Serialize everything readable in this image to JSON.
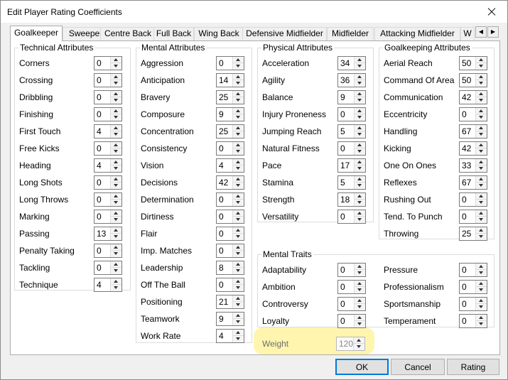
{
  "window": {
    "title": "Edit Player Rating Coefficients"
  },
  "tabs": [
    "Goalkeeper",
    "Sweeper",
    "Centre Back",
    "Full Back",
    "Wing Back",
    "Defensive Midfielder",
    "Midfielder",
    "Attacking Midfielder",
    "W"
  ],
  "active_tab": "Goalkeeper",
  "icons": {
    "close": "close-icon",
    "tab_left": "chevron-left-icon",
    "tab_right": "chevron-right-icon",
    "spin_up": "arrow-up-icon",
    "spin_down": "arrow-down-icon"
  },
  "groups": {
    "technical": {
      "legend": "Technical Attributes",
      "items": [
        {
          "label": "Corners",
          "value": "0"
        },
        {
          "label": "Crossing",
          "value": "0"
        },
        {
          "label": "Dribbling",
          "value": "0"
        },
        {
          "label": "Finishing",
          "value": "0"
        },
        {
          "label": "First Touch",
          "value": "4"
        },
        {
          "label": "Free Kicks",
          "value": "0"
        },
        {
          "label": "Heading",
          "value": "4"
        },
        {
          "label": "Long Shots",
          "value": "0"
        },
        {
          "label": "Long Throws",
          "value": "0"
        },
        {
          "label": "Marking",
          "value": "0"
        },
        {
          "label": "Passing",
          "value": "13"
        },
        {
          "label": "Penalty Taking",
          "value": "0"
        },
        {
          "label": "Tackling",
          "value": "0"
        },
        {
          "label": "Technique",
          "value": "4"
        }
      ]
    },
    "mental": {
      "legend": "Mental Attributes",
      "items": [
        {
          "label": "Aggression",
          "value": "0"
        },
        {
          "label": "Anticipation",
          "value": "14"
        },
        {
          "label": "Bravery",
          "value": "25"
        },
        {
          "label": "Composure",
          "value": "9"
        },
        {
          "label": "Concentration",
          "value": "25"
        },
        {
          "label": "Consistency",
          "value": "0"
        },
        {
          "label": "Vision",
          "value": "4"
        },
        {
          "label": "Decisions",
          "value": "42"
        },
        {
          "label": "Determination",
          "value": "0"
        },
        {
          "label": "Dirtiness",
          "value": "0"
        },
        {
          "label": "Flair",
          "value": "0"
        },
        {
          "label": "Imp. Matches",
          "value": "0"
        },
        {
          "label": "Leadership",
          "value": "8"
        },
        {
          "label": "Off The Ball",
          "value": "0"
        },
        {
          "label": "Positioning",
          "value": "21"
        },
        {
          "label": "Teamwork",
          "value": "9"
        },
        {
          "label": "Work Rate",
          "value": "4"
        }
      ]
    },
    "physical": {
      "legend": "Physical Attributes",
      "items": [
        {
          "label": "Acceleration",
          "value": "34"
        },
        {
          "label": "Agility",
          "value": "36"
        },
        {
          "label": "Balance",
          "value": "9"
        },
        {
          "label": "Injury Proneness",
          "value": "0"
        },
        {
          "label": "Jumping Reach",
          "value": "5"
        },
        {
          "label": "Natural Fitness",
          "value": "0"
        },
        {
          "label": "Pace",
          "value": "17"
        },
        {
          "label": "Stamina",
          "value": "5"
        },
        {
          "label": "Strength",
          "value": "18"
        },
        {
          "label": "Versatility",
          "value": "0"
        }
      ]
    },
    "goalkeeping": {
      "legend": "Goalkeeping Attributes",
      "items": [
        {
          "label": "Aerial Reach",
          "value": "50"
        },
        {
          "label": "Command Of Area",
          "value": "50"
        },
        {
          "label": "Communication",
          "value": "42"
        },
        {
          "label": "Eccentricity",
          "value": "0"
        },
        {
          "label": "Handling",
          "value": "67"
        },
        {
          "label": "Kicking",
          "value": "42"
        },
        {
          "label": "One On Ones",
          "value": "33"
        },
        {
          "label": "Reflexes",
          "value": "67"
        },
        {
          "label": "Rushing Out",
          "value": "0"
        },
        {
          "label": "Tend. To Punch",
          "value": "0"
        },
        {
          "label": "Throwing",
          "value": "25"
        }
      ]
    },
    "traits": {
      "legend": "Mental Traits",
      "items": [
        {
          "label": "Adaptability",
          "value": "0"
        },
        {
          "label": "Pressure",
          "value": "0"
        },
        {
          "label": "Ambition",
          "value": "0"
        },
        {
          "label": "Professionalism",
          "value": "0"
        },
        {
          "label": "Controversy",
          "value": "0"
        },
        {
          "label": "Sportsmanship",
          "value": "0"
        },
        {
          "label": "Loyalty",
          "value": "0"
        },
        {
          "label": "Temperament",
          "value": "0"
        }
      ]
    }
  },
  "weight": {
    "label": "Weight",
    "value": "120"
  },
  "buttons": {
    "ok": "OK",
    "cancel": "Cancel",
    "rating": "Rating"
  },
  "colors": {
    "highlight": "#ffec6e",
    "default_button_border": "#0078d7"
  }
}
